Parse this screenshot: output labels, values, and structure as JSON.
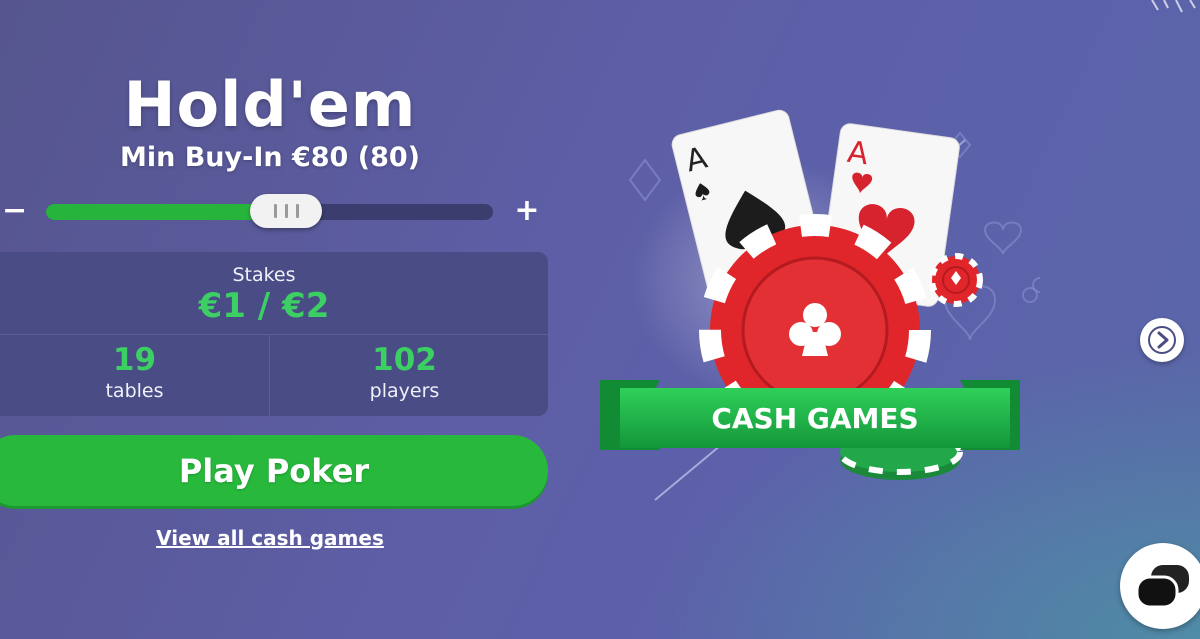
{
  "game": {
    "title": "Hold'em",
    "min_buyin": "Min Buy-In €80 (80)"
  },
  "buyin_slider": {
    "minus_label": "−",
    "plus_label": "+",
    "fill_fraction": 0.48
  },
  "stats": {
    "stakes_label": "Stakes",
    "stakes_value": "€1 / €2",
    "tables_count": "19",
    "tables_label": "tables",
    "players_count": "102",
    "players_label": "players"
  },
  "actions": {
    "play_label": "Play Poker",
    "view_all_label": "View all cash games"
  },
  "banner": {
    "ribbon_text": "CASH GAMES",
    "card_rank": "A"
  },
  "icons": {
    "next": "chevron-right-icon",
    "chat": "chat-bubbles-icon",
    "chip": "poker-chip-icon"
  },
  "colors": {
    "accent_green": "#27b83c",
    "value_green": "#3ccf63",
    "chip_red": "#e0262a",
    "ribbon_green": "#1fae48",
    "background": "#5c5ea6"
  }
}
